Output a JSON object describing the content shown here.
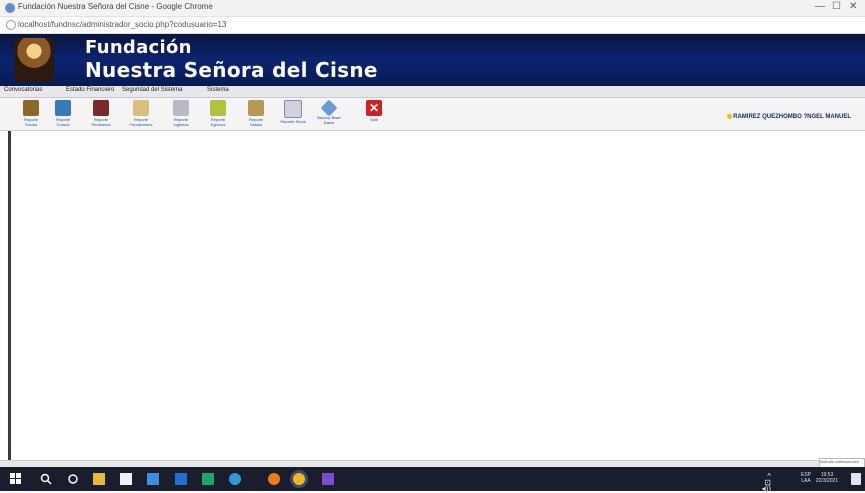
{
  "browser": {
    "window_title": "Fundación Nuestra Señora del Cisne - Google Chrome",
    "url": "localhost/fundnsc/administrador_socio.php?codusuario=13",
    "controls": {
      "minimize": "—",
      "maximize": "☐",
      "close": "✕"
    }
  },
  "banner": {
    "line1": "Fundación",
    "line2": "Nuestra Señora del Cisne"
  },
  "menu": [
    "Convocatorias",
    "Estado Financiero",
    "Seguridad del Sistema",
    "Sistema"
  ],
  "toolbar": {
    "buttons": [
      {
        "label": "Reporte Socios",
        "icon": "users-icon",
        "color": "#8a6a2a"
      },
      {
        "label": "Reporte Cursos",
        "icon": "course-icon",
        "color": "#3a7ab8"
      },
      {
        "label": "Reporte Reuniones",
        "icon": "meeting-icon",
        "color": "#7a2a2a"
      },
      {
        "label": "Reporte Fundaciones",
        "icon": "document-icon",
        "color": "#d8c080"
      },
      {
        "label": "Reporte Ingresos",
        "icon": "income-icon",
        "color": "#b9b9c4"
      },
      {
        "label": "Reporte Egresos",
        "icon": "expense-icon",
        "color": "#b4c040"
      },
      {
        "label": "Reporte Saldos",
        "icon": "balance-icon",
        "color": "#b39a5a"
      },
      {
        "label": "Reporte Stock",
        "icon": "stock-icon",
        "color": "#d0d0e0"
      },
      {
        "label": "Backup Base Datos",
        "icon": "backup-icon",
        "color": "#6a9ad8"
      },
      {
        "label": "Salir",
        "icon": "exit-icon",
        "color": "#d21e1e"
      }
    ],
    "user": "RAMIREZ QUEZHOMBO ?NGEL MANUEL"
  },
  "notification": "Nuevas notificaciones",
  "taskbar": {
    "lang_line1": "ESP",
    "lang_line2": "LAA",
    "time": "19:53",
    "date": "22/3/2021",
    "icons": [
      "windows-start-icon",
      "search-icon",
      "task-view-icon",
      "file-explorer-icon",
      "store-icon",
      "mail-icon",
      "outlook-icon",
      "excel-icon",
      "edge-icon",
      "firefox-icon",
      "chrome-icon",
      "visual-studio-icon"
    ]
  }
}
